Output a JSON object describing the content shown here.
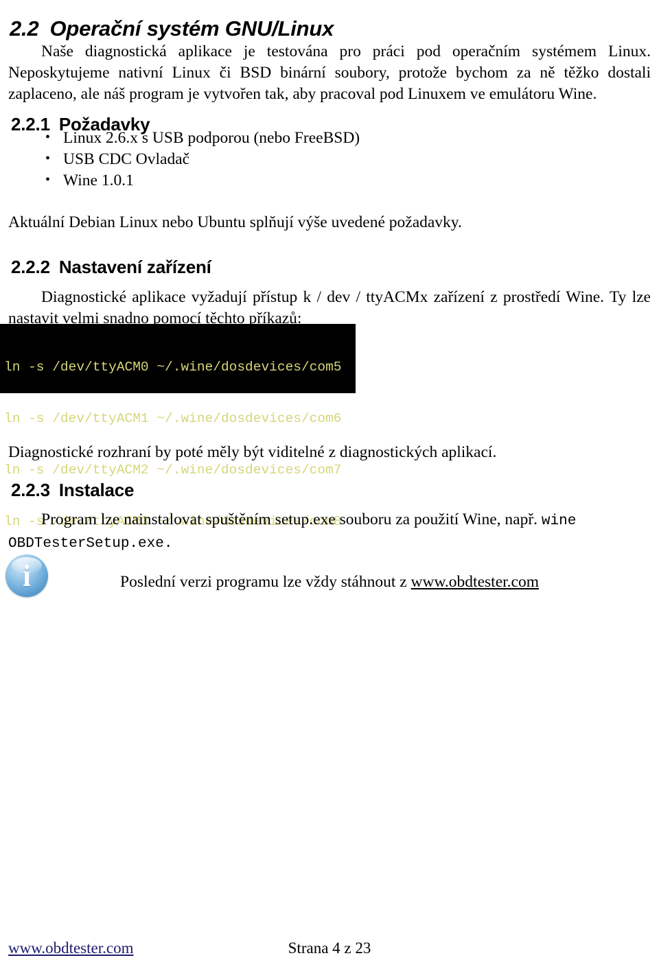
{
  "document": {
    "language": "cs",
    "section_heading": {
      "number": "2.2",
      "title": "Operační systém GNU/Linux"
    },
    "intro_paragraph": "Naše diagnostická aplikace je testována pro práci pod operačním systémem Linux. Neposkytujeme nativní Linux či BSD binární soubory, protože bychom za ně těžko dostali zaplaceno, ale náš program je vytvořen tak, aby pracoval pod Linuxem ve emulátoru Wine.",
    "requirements_section": {
      "number": "2.2.1",
      "title": "Požadavky",
      "bullets": [
        "Linux 2.6.x s USB podporou (nebo FreeBSD)",
        "USB CDC Ovladač",
        "Wine 1.0.1"
      ],
      "note": "Aktuální Debian Linux nebo Ubuntu splňují výše uvedené požadavky."
    },
    "device_setup_section": {
      "number": "2.2.2",
      "title": "Nastavení zařízení",
      "paragraph": "Diagnostické aplikace vyžadují přístup k / dev / ttyACMx zařízení z prostředí Wine. Ty lze nastavit velmi snadno pomocí těchto příkazů:",
      "code_lines": [
        "ln -s /dev/ttyACM0 ~/.wine/dosdevices/com5",
        "ln -s /dev/ttyACM1 ~/.wine/dosdevices/com6",
        "ln -s /dev/ttyACM2 ~/.wine/dosdevices/com7",
        "ln -s /dev/ttyACM3 ~/.wine/dosdevices/com8"
      ],
      "code_bg_color": "#000000",
      "code_text_color": "#d6d67a",
      "after_code_paragraph": "Diagnostické rozhraní by poté měly být viditelné z diagnostických aplikací."
    },
    "install_section": {
      "number": "2.2.3",
      "title": "Instalace",
      "paragraph_part1": "Program lze nainstalovat spuštěním setup.exe souboru za použití Wine, např. ",
      "paragraph_mono": "wine OBDTesterSetup.exe",
      "paragraph_part2": "."
    },
    "info_note": {
      "icon": "info-icon",
      "text_before_link": "Poslední verzi programu lze vždy stáhnout z ",
      "link_text": "www.obdtester.com"
    },
    "footer": {
      "left_link": "www.obdtester.com",
      "center_text": "Strana 4 z 23"
    }
  }
}
